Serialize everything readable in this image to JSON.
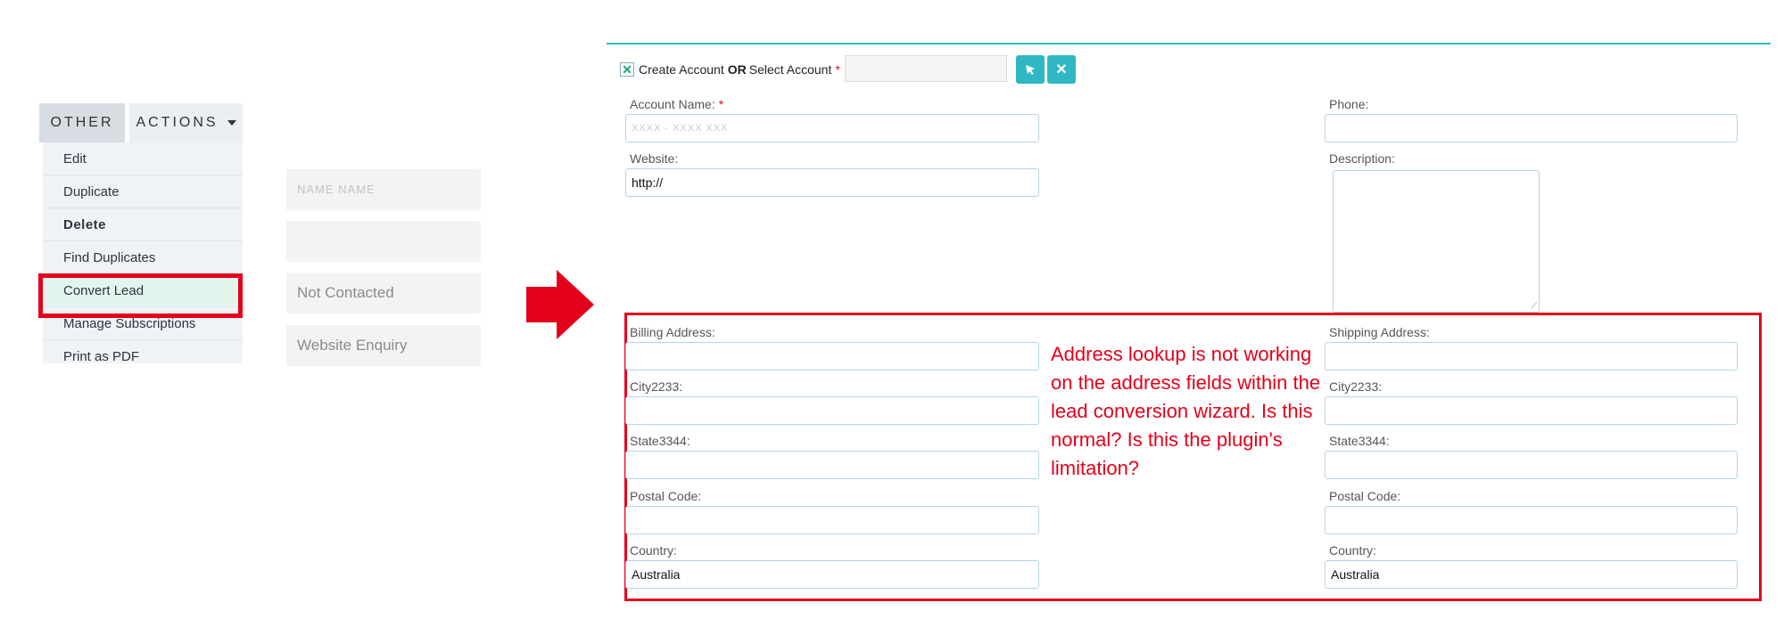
{
  "menu": {
    "tabs": [
      {
        "label": "OTHER"
      },
      {
        "label": "ACTIONS"
      }
    ],
    "items": [
      {
        "label": "Edit"
      },
      {
        "label": "Duplicate"
      },
      {
        "label": "Delete"
      },
      {
        "label": "Find Duplicates"
      },
      {
        "label": "Convert Lead"
      },
      {
        "label": "Manage Subscriptions"
      },
      {
        "label": "Print as PDF"
      }
    ]
  },
  "lead_fields": [
    {
      "value": "NAME NAME"
    },
    {
      "value": ""
    },
    {
      "value": "Not Contacted"
    },
    {
      "value": "Website Enquiry"
    }
  ],
  "form": {
    "create_account_text": "Create Account",
    "or_text": "OR",
    "select_account_text": "Select Account",
    "required_mark": "*",
    "select_icon": "cursor-arrow-icon",
    "clear_icon": "close-icon",
    "account_name": {
      "label": "Account Name:",
      "value": "XXXX - XXXX XXX"
    },
    "phone": {
      "label": "Phone:",
      "value": ""
    },
    "website": {
      "label": "Website:",
      "value": "http://"
    },
    "description": {
      "label": "Description:",
      "value": ""
    },
    "billing_address": {
      "label": "Billing Address:",
      "value": ""
    },
    "shipping_address": {
      "label": "Shipping Address:",
      "value": ""
    },
    "billing_city": {
      "label": "City2233:",
      "value": ""
    },
    "shipping_city": {
      "label": "City2233:",
      "value": ""
    },
    "billing_state": {
      "label": "State3344:",
      "value": ""
    },
    "shipping_state": {
      "label": "State3344:",
      "value": ""
    },
    "billing_postal": {
      "label": "Postal Code:",
      "value": ""
    },
    "shipping_postal": {
      "label": "Postal Code:",
      "value": ""
    },
    "billing_country": {
      "label": "Country:",
      "value": "Australia"
    },
    "shipping_country": {
      "label": "Country:",
      "value": "Australia"
    }
  },
  "annotation": {
    "note": "Address lookup is not working on the address fields within the lead conversion wizard. Is this normal? Is this the plugin's limitation?"
  },
  "colors": {
    "highlight": "#e3001b",
    "accent": "#2fb7c4",
    "field_border": "#b6d4e3"
  }
}
